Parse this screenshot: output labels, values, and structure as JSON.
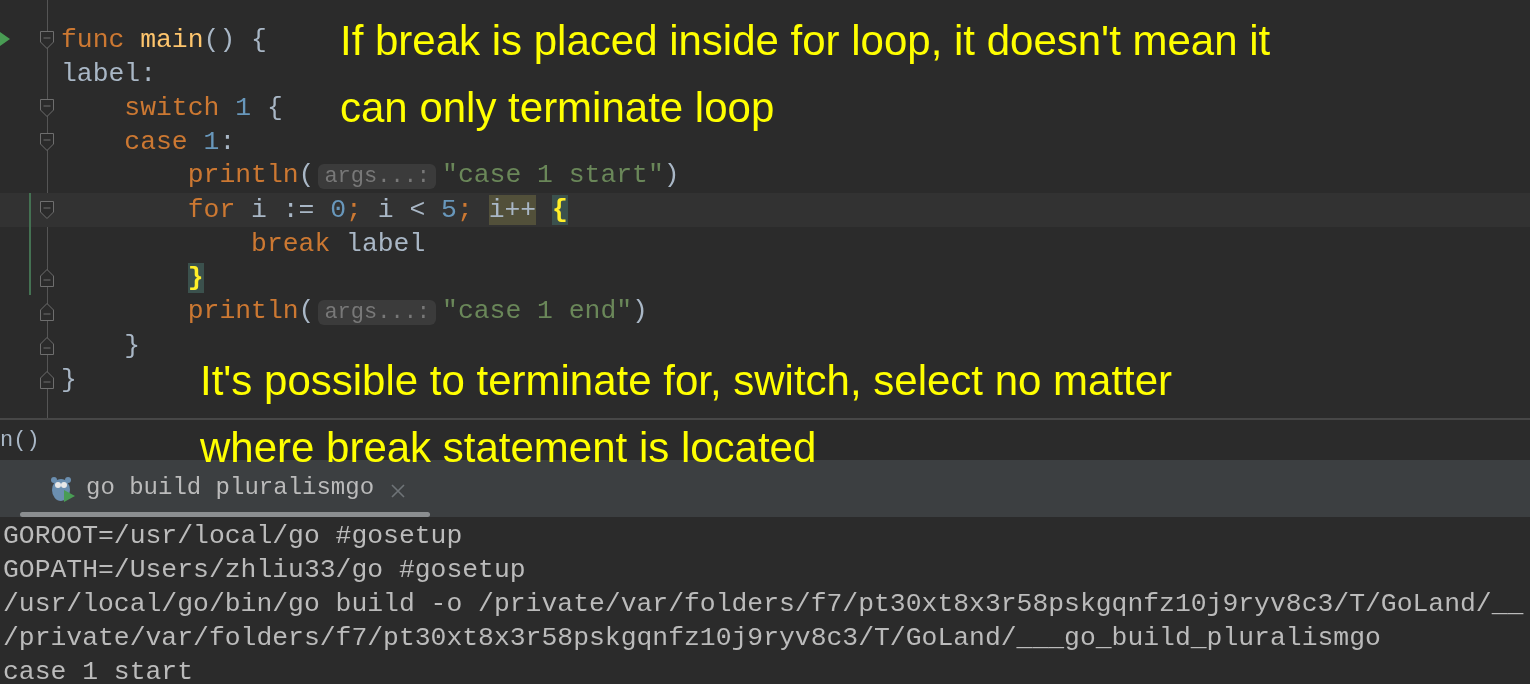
{
  "editor": {
    "lines": [
      {
        "run": true,
        "fold_start": true,
        "fold_end": false,
        "current": false,
        "modified": false,
        "kind": "flat",
        "tokens": [
          {
            "kind": "kw",
            "text": "func"
          },
          {
            "kind": "fn",
            "text": "main"
          },
          {
            "kind": "punct",
            "text": "() {"
          }
        ]
      },
      {
        "run": false,
        "fold_start": false,
        "fold_end": false,
        "current": false,
        "modified": false,
        "kind": "flat",
        "tokens": [
          {
            "kind": "id",
            "text": "label:"
          }
        ]
      },
      {
        "run": false,
        "fold_start": true,
        "fold_end": false,
        "current": false,
        "modified": false,
        "kind": "indent1",
        "tokens": [
          {
            "kind": "kw",
            "text": "switch"
          },
          {
            "kind": "num",
            "text": "1"
          },
          {
            "kind": "id",
            "text": "{"
          }
        ]
      },
      {
        "run": false,
        "fold_start": true,
        "fold_end": false,
        "current": false,
        "modified": false,
        "kind": "indent1",
        "tokens": [
          {
            "kind": "kw",
            "text": "case"
          },
          {
            "kind": "num",
            "text": "1"
          },
          {
            "kind": "punct",
            "text": ":"
          }
        ]
      },
      {
        "run": false,
        "fold_start": false,
        "fold_end": false,
        "current": false,
        "modified": false,
        "kind": "indent2",
        "tokens": [
          {
            "kind": "kw",
            "text": "println"
          },
          {
            "kind": "punct",
            "text": "("
          },
          {
            "kind": "hint",
            "text": "args...:"
          },
          {
            "kind": "str",
            "text": "\"case 1 start\""
          },
          {
            "kind": "punct",
            "text": ")"
          }
        ]
      },
      {
        "run": false,
        "fold_start": true,
        "fold_end": false,
        "current": true,
        "modified": true,
        "kind": "indent2",
        "tokens": [
          {
            "kind": "kw",
            "text": "for"
          },
          {
            "kind": "id",
            "text": "i :="
          },
          {
            "kind": "num",
            "text": "0"
          },
          {
            "kind": "semi",
            "text": ";"
          },
          {
            "kind": "id",
            "text": "i <"
          },
          {
            "kind": "num",
            "text": "5"
          },
          {
            "kind": "semi",
            "text": ";"
          },
          {
            "kind": "usage",
            "text": "i++"
          },
          {
            "kind": "brace",
            "text": "{"
          }
        ]
      },
      {
        "run": false,
        "fold_start": false,
        "fold_end": false,
        "current": false,
        "modified": true,
        "kind": "indent3",
        "tokens": [
          {
            "kind": "kw",
            "text": "break"
          },
          {
            "kind": "id",
            "text": "label"
          }
        ]
      },
      {
        "run": false,
        "fold_start": false,
        "fold_end": true,
        "current": false,
        "modified": true,
        "kind": "indent2",
        "tokens": [
          {
            "kind": "brace",
            "text": "}"
          }
        ]
      },
      {
        "run": false,
        "fold_start": false,
        "fold_end": true,
        "current": false,
        "modified": false,
        "kind": "indent2",
        "tokens": [
          {
            "kind": "kw",
            "text": "println"
          },
          {
            "kind": "punct",
            "text": "("
          },
          {
            "kind": "hint",
            "text": "args...:"
          },
          {
            "kind": "str",
            "text": "\"case 1 end\""
          },
          {
            "kind": "punct",
            "text": ")"
          }
        ]
      },
      {
        "run": false,
        "fold_start": false,
        "fold_end": true,
        "current": false,
        "modified": false,
        "kind": "indent1",
        "tokens": [
          {
            "kind": "id",
            "text": "}"
          }
        ]
      },
      {
        "run": false,
        "fold_start": false,
        "fold_end": true,
        "current": false,
        "modified": false,
        "kind": "flat",
        "tokens": [
          {
            "kind": "id",
            "text": "}"
          }
        ]
      }
    ]
  },
  "breadcrumb": "n()",
  "run_tab": {
    "label": "go build pluralismgo"
  },
  "console": [
    "GOROOT=/usr/local/go #gosetup",
    "GOPATH=/Users/zhliu33/go #gosetup",
    "/usr/local/go/bin/go build -o /private/var/folders/f7/pt30xt8x3r58pskgqnfz10j9ryv8c3/T/GoLand/__",
    "/private/var/folders/f7/pt30xt8x3r58pskgqnfz10j9ryv8c3/T/GoLand/___go_build_pluralismgo",
    "case 1 start"
  ],
  "annotations": [
    {
      "lines": [
        "If break is placed inside for loop, it doesn't mean it",
        "can only terminate loop"
      ]
    },
    {
      "lines": [
        "It's possible to terminate for, switch, select no matter",
        "where break statement is located"
      ]
    }
  ]
}
